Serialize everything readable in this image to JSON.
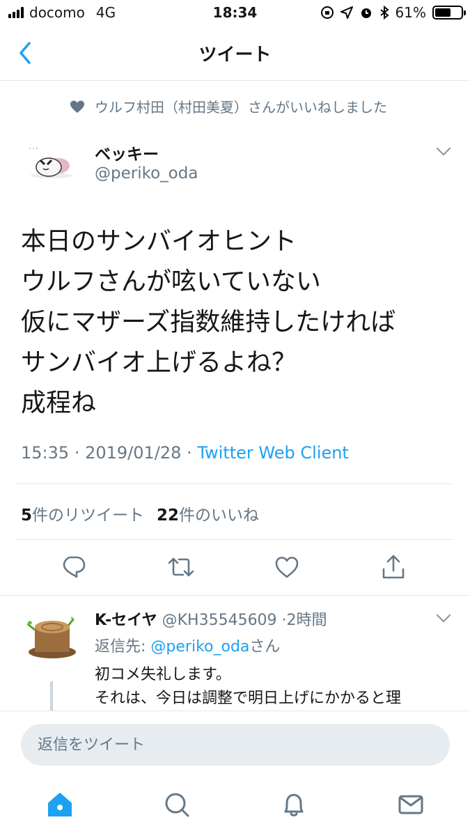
{
  "status_bar": {
    "carrier": "docomo",
    "network": "4G",
    "time": "18:34",
    "battery": "61%",
    "battery_level": 0.61
  },
  "nav": {
    "title": "ツイート"
  },
  "liked_context": {
    "text": "ウルフ村田（村田美夏）さんがいいねしました"
  },
  "tweet": {
    "author_name": "ベッキー",
    "author_handle": "@periko_oda",
    "lines": [
      "本日のサンバイオヒント",
      "ウルフさんが呟いていない",
      "仮にマザーズ指数維持したければ",
      "サンバイオ上げるよね？",
      "成程ね"
    ],
    "time": "15:35",
    "date": "2019/01/28",
    "separator": "·",
    "client": "Twitter Web Client",
    "retweet_count": "5",
    "retweet_label": "件のリツイート",
    "like_count": "22",
    "like_label": "件のいいね"
  },
  "reply": {
    "name": "K-セイヤ",
    "handle": "@KH35545609",
    "time": "·2時間",
    "reply_to_prefix": "返信先: ",
    "reply_to_handle": "@periko_oda",
    "reply_to_suffix": "さん",
    "body_lines": [
      "初コメ失礼します。",
      "それは、今日は調整で明日上げにかかると理"
    ]
  },
  "compose": {
    "placeholder": "返信をツイート"
  },
  "icons": {
    "back": "chevron-left-icon",
    "liked": "heart-icon",
    "caret": "chevron-down-icon",
    "reply": "speech-bubble-icon",
    "retweet": "retweet-icon",
    "like": "heart-outline-icon",
    "share": "share-icon",
    "home": "home-icon",
    "search": "search-icon",
    "notifications": "bell-icon",
    "messages": "mail-icon"
  },
  "colors": {
    "accent": "#1da1f2",
    "muted": "#657786",
    "text": "#14171a"
  }
}
